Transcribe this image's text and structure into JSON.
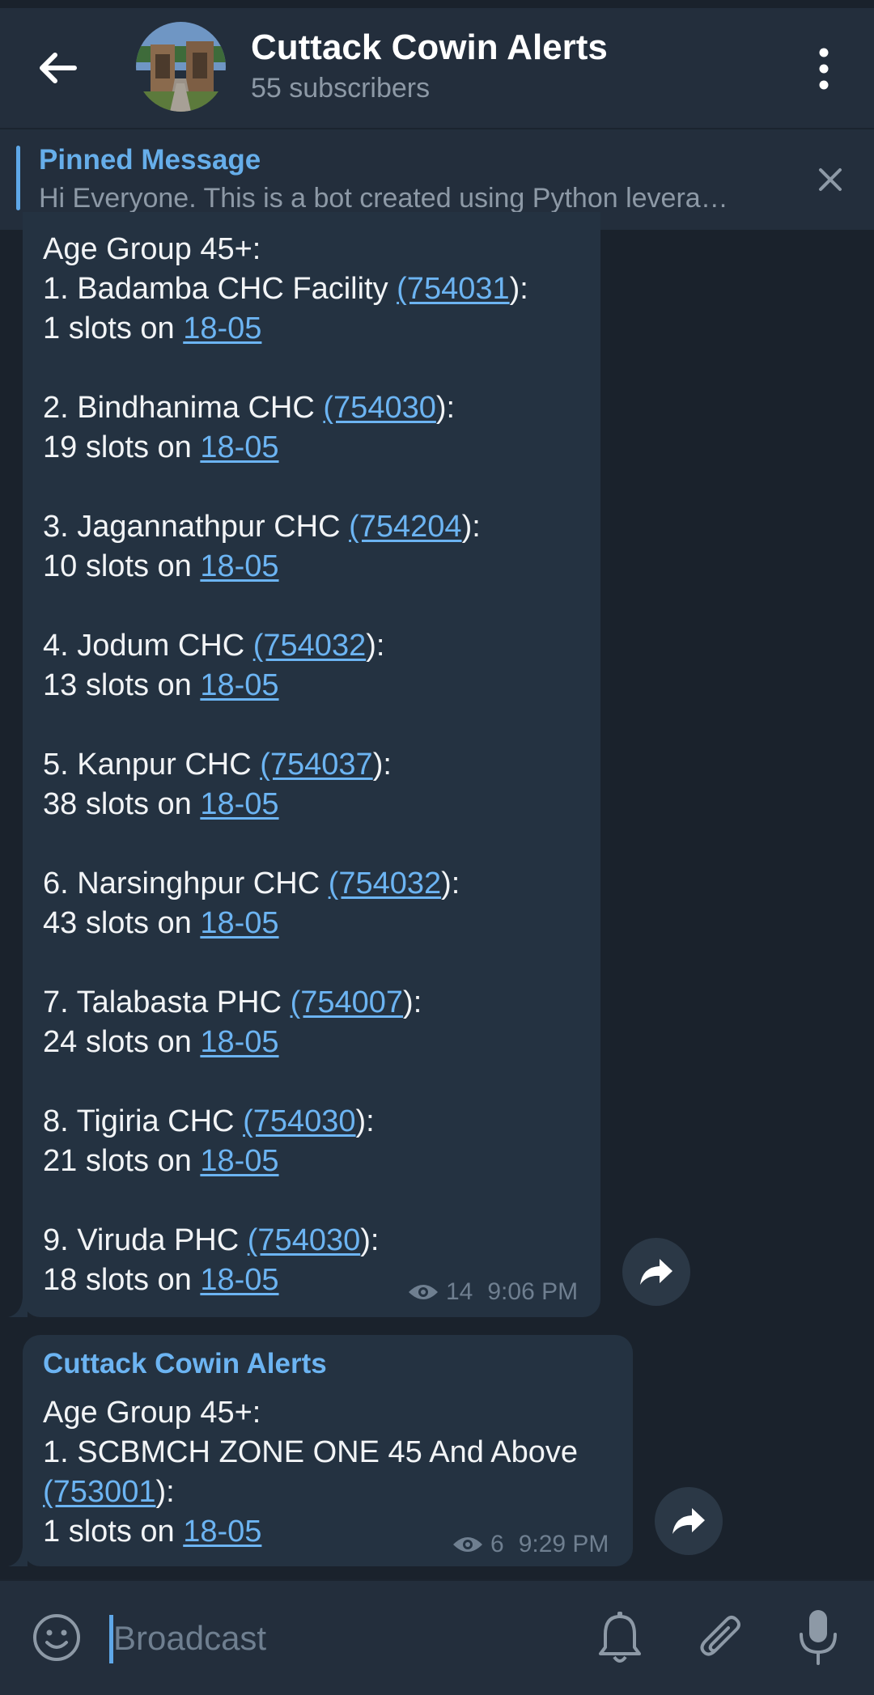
{
  "header": {
    "title": "Cuttack Cowin Alerts",
    "subtitle": "55 subscribers"
  },
  "pinned": {
    "title": "Pinned Message",
    "text": "Hi Everyone. This is a bot created using Python levera…"
  },
  "messages": [
    {
      "heading": "Age Group 45+:",
      "entries": [
        {
          "prefix": "1. Badamba CHC Facility ",
          "pincode": "(754031",
          "suffix": "):",
          "slots_prefix": "1 slots on ",
          "date": "18-05"
        },
        {
          "prefix": "2. Bindhanima CHC ",
          "pincode": "(754030",
          "suffix": "):",
          "slots_prefix": "19 slots on ",
          "date": "18-05"
        },
        {
          "prefix": "3. Jagannathpur CHC ",
          "pincode": "(754204",
          "suffix": "):",
          "slots_prefix": "10 slots on ",
          "date": "18-05"
        },
        {
          "prefix": "4. Jodum CHC ",
          "pincode": "(754032",
          "suffix": "):",
          "slots_prefix": "13 slots on ",
          "date": "18-05"
        },
        {
          "prefix": "5. Kanpur CHC ",
          "pincode": "(754037",
          "suffix": "):",
          "slots_prefix": "38 slots on ",
          "date": "18-05"
        },
        {
          "prefix": "6. Narsinghpur CHC ",
          "pincode": "(754032",
          "suffix": "):",
          "slots_prefix": "43 slots on ",
          "date": "18-05"
        },
        {
          "prefix": "7. Talabasta PHC ",
          "pincode": "(754007",
          "suffix": "):",
          "slots_prefix": "24 slots on ",
          "date": "18-05"
        },
        {
          "prefix": "8. Tigiria CHC ",
          "pincode": "(754030",
          "suffix": "):",
          "slots_prefix": "21 slots on ",
          "date": "18-05"
        },
        {
          "prefix": "9. Viruda PHC ",
          "pincode": "(754030",
          "suffix": "):",
          "slots_prefix": "18 slots on ",
          "date": "18-05"
        }
      ],
      "views": "14",
      "time": "9:06 PM"
    },
    {
      "sender": "Cuttack Cowin Alerts",
      "heading": "Age Group 45+:",
      "line1": "1. SCBMCH ZONE ONE 45 And Above",
      "pincode": "(753001",
      "suffix": "):",
      "slots_prefix": "1 slots on ",
      "date": "18-05",
      "views": "6",
      "time": "9:29 PM"
    }
  ],
  "composer": {
    "placeholder": "Broadcast"
  },
  "colors": {
    "background": "#1a222c",
    "header": "#232e3c",
    "bubble": "#243241",
    "accent": "#6cb4f2",
    "muted": "#8d99a6"
  },
  "icons": [
    "back-arrow-icon",
    "more-vertical-icon",
    "close-icon",
    "eye-icon",
    "share-arrow-icon",
    "emoji-icon",
    "bell-icon",
    "paperclip-icon",
    "microphone-icon"
  ]
}
